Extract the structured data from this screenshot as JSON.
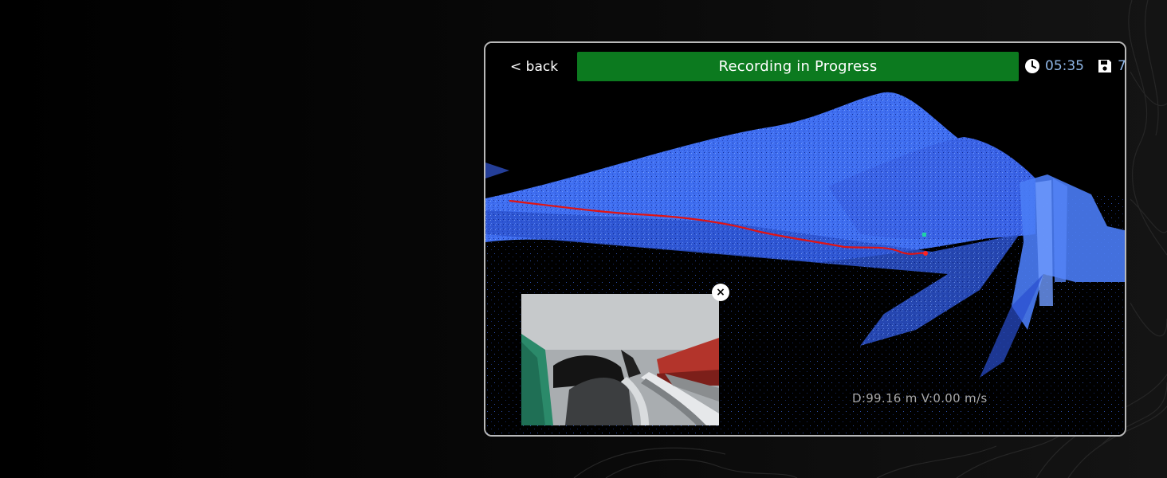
{
  "header": {
    "back_label": "< back",
    "status_label": "Recording in Progress",
    "elapsed_time": "05:35",
    "saved_count": "7"
  },
  "telemetry": {
    "text": "D:99.16 m V:0.00 m/s"
  },
  "preview": {
    "close_label": "×"
  },
  "icons": {
    "clock": "clock-icon",
    "save": "save-icon",
    "close": "close-icon"
  },
  "colors": {
    "status_banner": "#0c7a1f",
    "point_cloud": "#3f6ef0",
    "trajectory": "#e01414",
    "readout_text": "#8fb7e8"
  }
}
